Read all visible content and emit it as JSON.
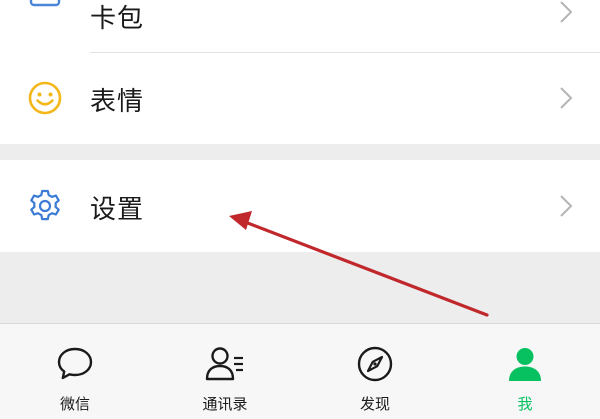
{
  "menu": {
    "items": [
      {
        "label": "卡包",
        "icon": "card-wallet-icon"
      },
      {
        "label": "表情",
        "icon": "smiley-icon"
      },
      {
        "label": "设置",
        "icon": "gear-icon"
      }
    ]
  },
  "tabbar": {
    "tabs": [
      {
        "label": "微信",
        "icon": "chat-bubble-icon",
        "active": false
      },
      {
        "label": "通讯录",
        "icon": "contacts-icon",
        "active": false
      },
      {
        "label": "发现",
        "icon": "compass-icon",
        "active": false
      },
      {
        "label": "我",
        "icon": "person-icon",
        "active": true
      }
    ]
  },
  "colors": {
    "accent": "#07c160",
    "annotation_arrow": "#c0282c",
    "settings_icon": "#3a7bd5",
    "stickers_icon": "#f3b71a",
    "cards_icon": "#4a86d8"
  }
}
